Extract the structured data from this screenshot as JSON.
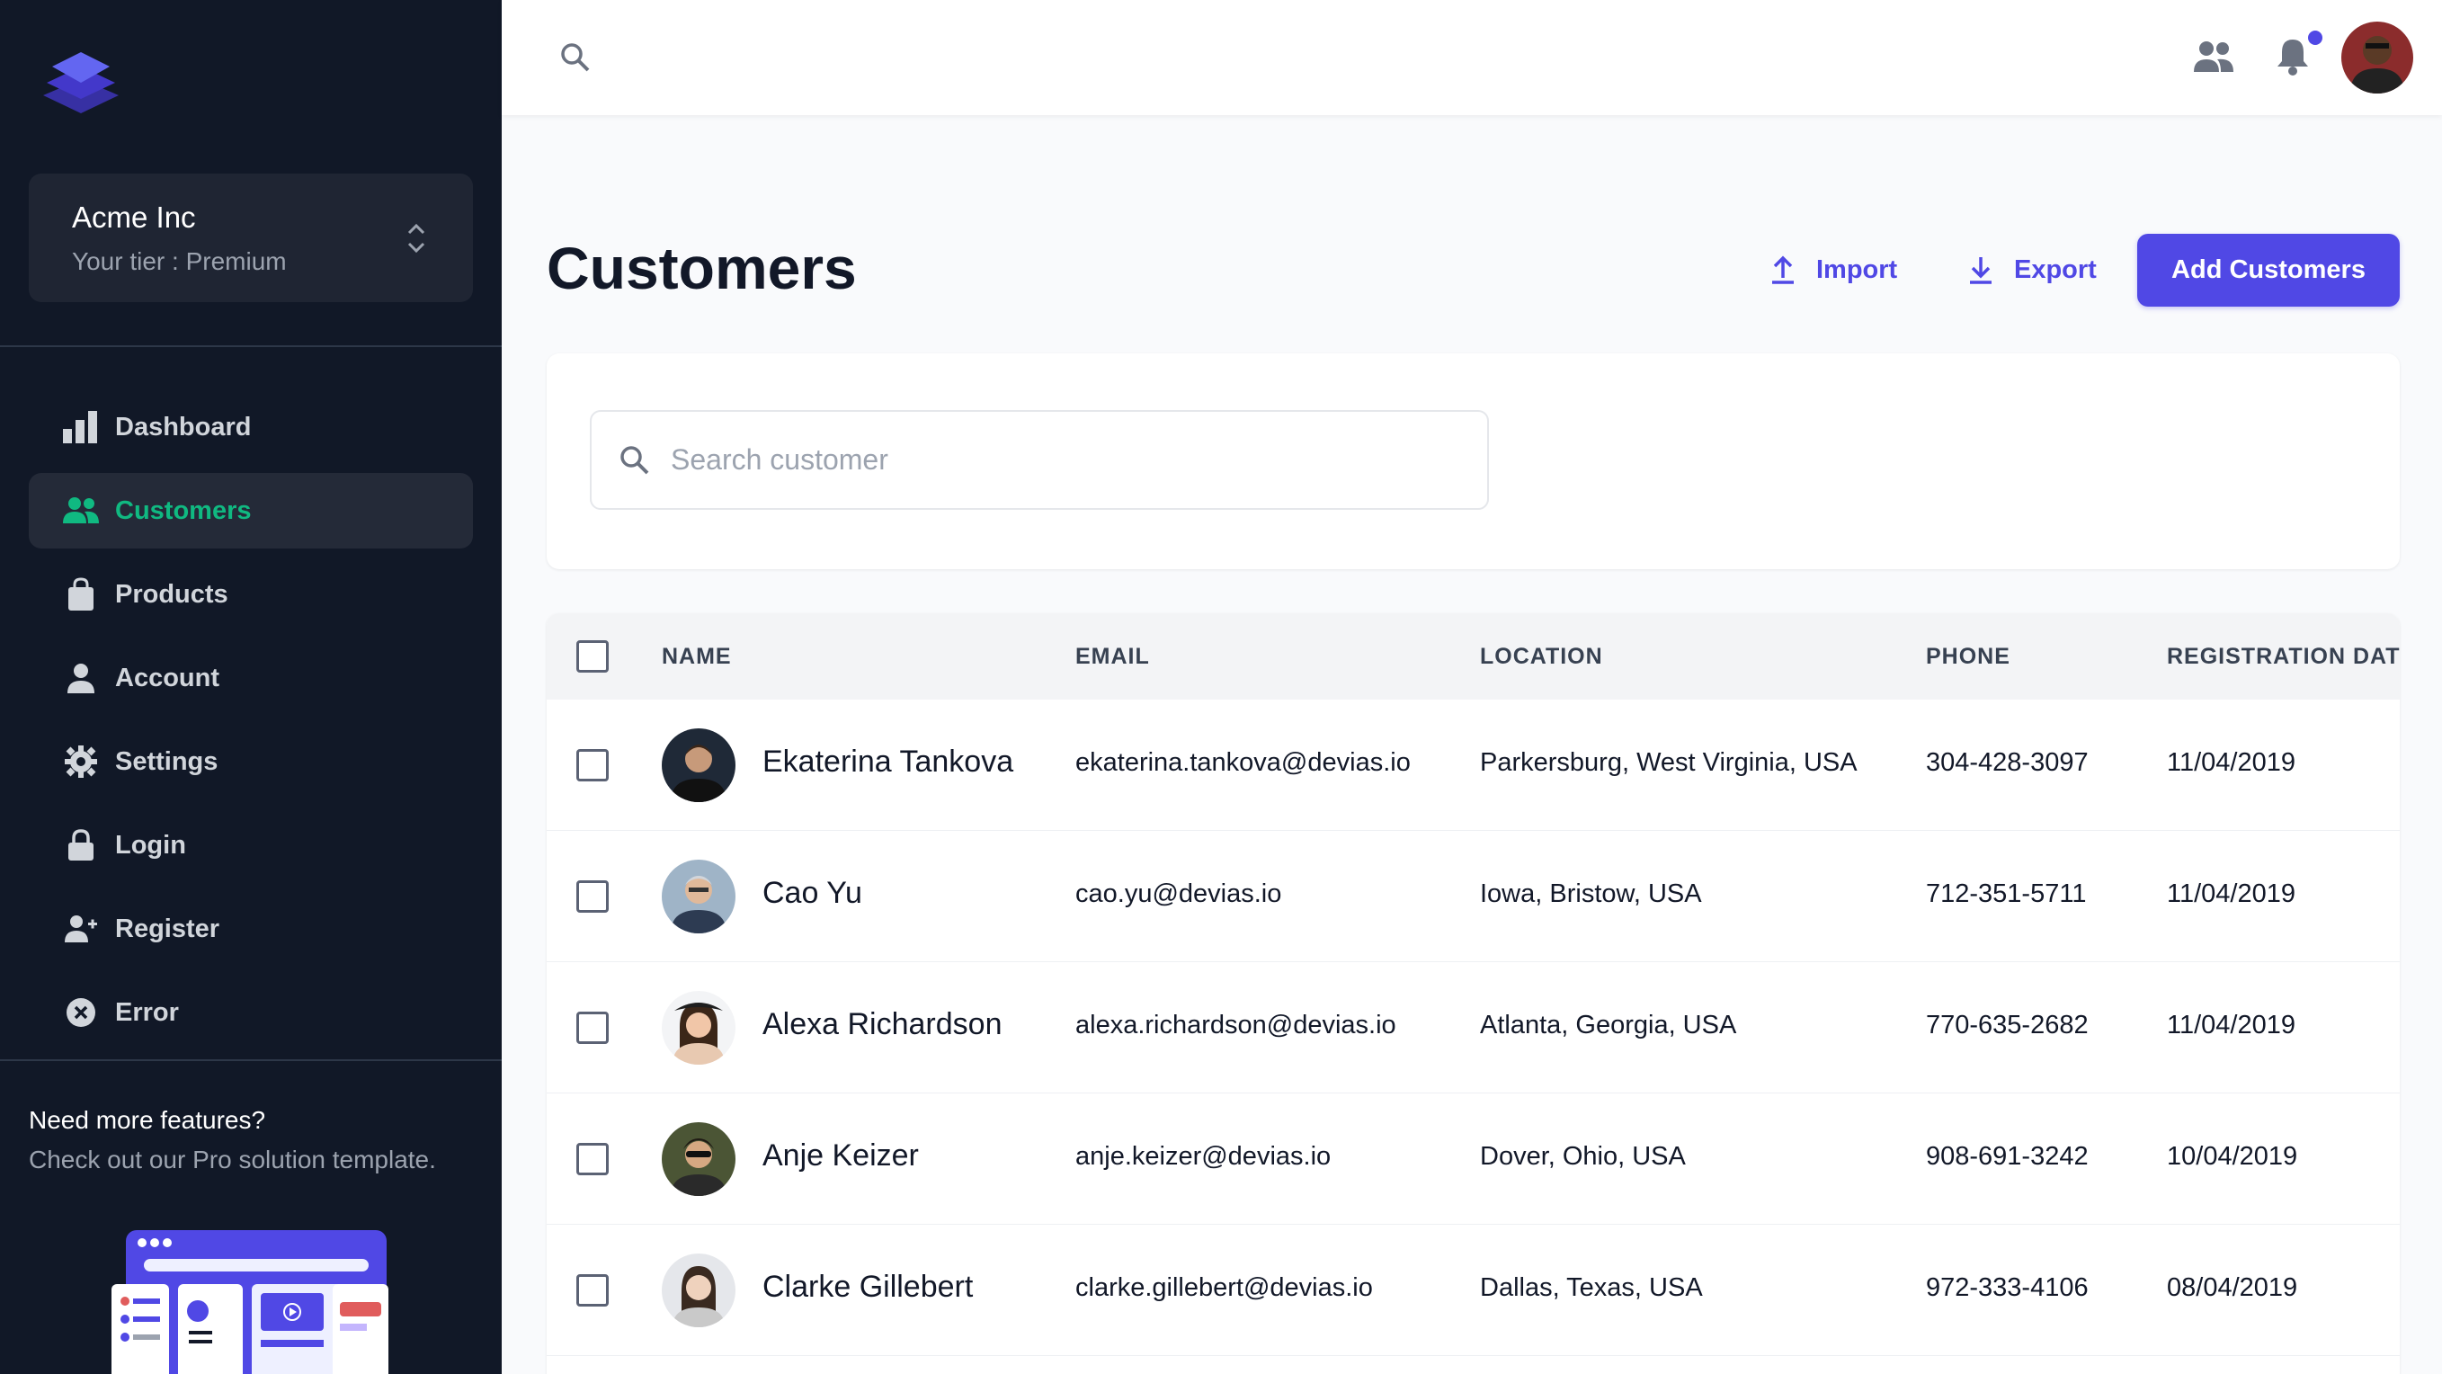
{
  "org": {
    "name": "Acme Inc",
    "tier": "Your tier : Premium"
  },
  "nav": [
    {
      "label": "Dashboard",
      "icon": "bar-chart-icon",
      "active": false
    },
    {
      "label": "Customers",
      "icon": "users-icon",
      "active": true
    },
    {
      "label": "Products",
      "icon": "shopping-bag-icon",
      "active": false
    },
    {
      "label": "Account",
      "icon": "user-icon",
      "active": false
    },
    {
      "label": "Settings",
      "icon": "gear-icon",
      "active": false
    },
    {
      "label": "Login",
      "icon": "lock-icon",
      "active": false
    },
    {
      "label": "Register",
      "icon": "user-add-icon",
      "active": false
    },
    {
      "label": "Error",
      "icon": "x-circle-icon",
      "active": false
    }
  ],
  "promo": {
    "title": "Need more features?",
    "subtitle": "Check out our Pro solution template."
  },
  "page": {
    "title": "Customers",
    "import_label": "Import",
    "export_label": "Export",
    "add_label": "Add Customers"
  },
  "search": {
    "placeholder": "Search customer",
    "value": ""
  },
  "table": {
    "headers": [
      "NAME",
      "EMAIL",
      "LOCATION",
      "PHONE",
      "REGISTRATION DATE"
    ],
    "rows": [
      {
        "name": "Ekaterina Tankova",
        "email": "ekaterina.tankova@devias.io",
        "location": "Parkersburg, West Virginia, USA",
        "phone": "304-428-3097",
        "date": "11/04/2019"
      },
      {
        "name": "Cao Yu",
        "email": "cao.yu@devias.io",
        "location": "Iowa, Bristow, USA",
        "phone": "712-351-5711",
        "date": "11/04/2019"
      },
      {
        "name": "Alexa Richardson",
        "email": "alexa.richardson@devias.io",
        "location": "Atlanta, Georgia, USA",
        "phone": "770-635-2682",
        "date": "11/04/2019"
      },
      {
        "name": "Anje Keizer",
        "email": "anje.keizer@devias.io",
        "location": "Dover, Ohio, USA",
        "phone": "908-691-3242",
        "date": "10/04/2019"
      },
      {
        "name": "Clarke Gillebert",
        "email": "clarke.gillebert@devias.io",
        "location": "Dallas, Texas, USA",
        "phone": "972-333-4106",
        "date": "08/04/2019"
      }
    ]
  },
  "colors": {
    "primary": "#5048e5",
    "sidebar": "#111827",
    "active_nav": "#10b981"
  }
}
